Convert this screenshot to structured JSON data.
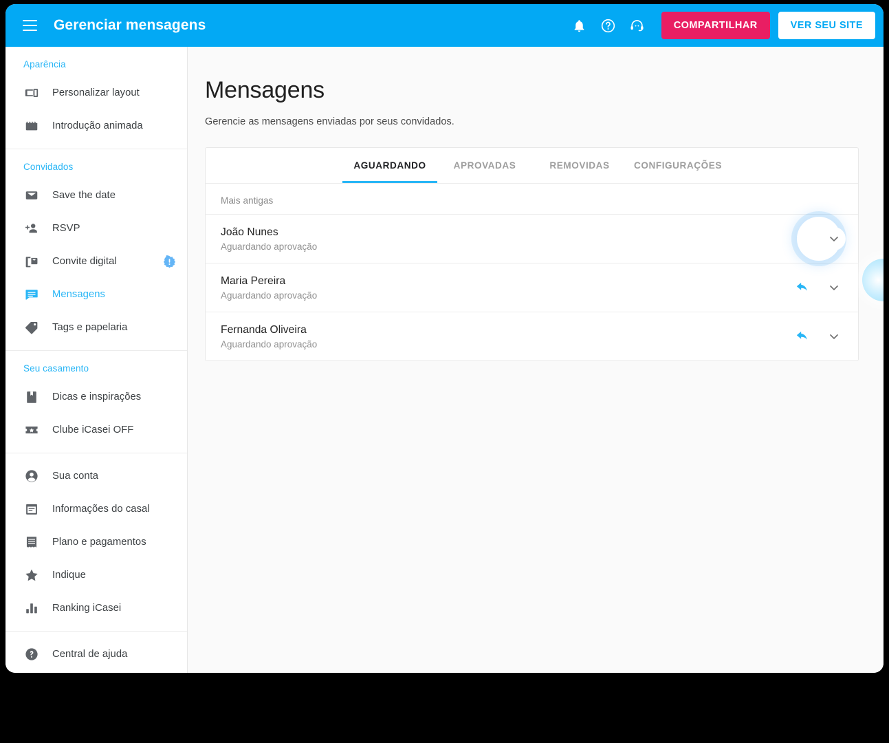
{
  "appbar": {
    "menu_icon": "hamburger-menu-icon",
    "title": "Gerenciar mensagens",
    "icons": [
      {
        "name": "notifications-bell-icon",
        "label": "Notificações"
      },
      {
        "name": "help-circle-icon",
        "label": "Ajuda"
      },
      {
        "name": "support-headset-icon",
        "label": "Suporte"
      }
    ],
    "share_button": "COMPARTILHAR",
    "site_button": "VER SEU SITE",
    "bar_color": "#03A9F4",
    "share_color": "#E91E63",
    "site_text_color": "#03A9F4"
  },
  "sidebar": {
    "groups": [
      {
        "heading": "Aparência",
        "items": [
          {
            "label": "Personalizar layout",
            "icon": "devices-icon",
            "active": false,
            "badge": false
          },
          {
            "label": "Introdução animada",
            "icon": "movie-clapper-icon",
            "active": false,
            "badge": false
          }
        ]
      },
      {
        "heading": "Convidados",
        "items": [
          {
            "label": "Save the date",
            "icon": "envelope-icon",
            "active": false,
            "badge": false
          },
          {
            "label": "RSVP",
            "icon": "person-add-icon",
            "active": false,
            "badge": false
          },
          {
            "label": "Convite digital",
            "icon": "mobile-message-icon",
            "active": false,
            "badge": true
          },
          {
            "label": "Mensagens",
            "icon": "chat-bubble-icon",
            "active": true,
            "badge": false
          },
          {
            "label": "Tags e papelaria",
            "icon": "tag-icon",
            "active": false,
            "badge": false
          }
        ]
      },
      {
        "heading": "Seu casamento",
        "items": [
          {
            "label": "Dicas e inspirações",
            "icon": "book-bookmark-icon",
            "active": false,
            "badge": false
          },
          {
            "label": "Clube iCasei OFF",
            "icon": "ticket-star-icon",
            "active": false,
            "badge": false
          }
        ]
      },
      {
        "heading": "",
        "items": [
          {
            "label": "Sua conta",
            "icon": "account-circle-icon",
            "active": false,
            "badge": false
          },
          {
            "label": "Informações do casal",
            "icon": "calendar-note-icon",
            "active": false,
            "badge": false
          },
          {
            "label": "Plano e pagamentos",
            "icon": "receipt-icon",
            "active": false,
            "badge": false
          },
          {
            "label": "Indique",
            "icon": "star-icon",
            "active": false,
            "badge": false
          },
          {
            "label": "Ranking iCasei",
            "icon": "bar-chart-icon",
            "active": false,
            "badge": false
          }
        ]
      },
      {
        "heading": "",
        "items": [
          {
            "label": "Central de ajuda",
            "icon": "help-circle-filled-icon",
            "active": false,
            "badge": false
          }
        ]
      }
    ],
    "heading_color": "#29B6F6",
    "active_color": "#29B6F6",
    "badge_color": "#64B5F6"
  },
  "main": {
    "title": "Mensagens",
    "subtitle": "Gerencie as mensagens enviadas por seus convidados.",
    "tabs": [
      {
        "label": "AGUARDANDO",
        "active": true
      },
      {
        "label": "APROVADAS",
        "active": false
      },
      {
        "label": "REMOVIDAS",
        "active": false
      },
      {
        "label": "CONFIGURAÇÕES",
        "active": false
      }
    ],
    "list_caption": "Mais antigas",
    "messages": [
      {
        "name": "João Nunes",
        "status": "Aguardando aprovação",
        "focused": true
      },
      {
        "name": "Maria Pereira",
        "status": "Aguardando aprovação",
        "focused": false
      },
      {
        "name": "Fernanda Oliveira",
        "status": "Aguardando aprovação",
        "focused": false
      }
    ],
    "reply_icon": "reply-arrow-icon",
    "expand_icon": "chevron-down-icon",
    "reply_color": "#29B6F6",
    "tab_active_underline": "#29B6F6"
  }
}
